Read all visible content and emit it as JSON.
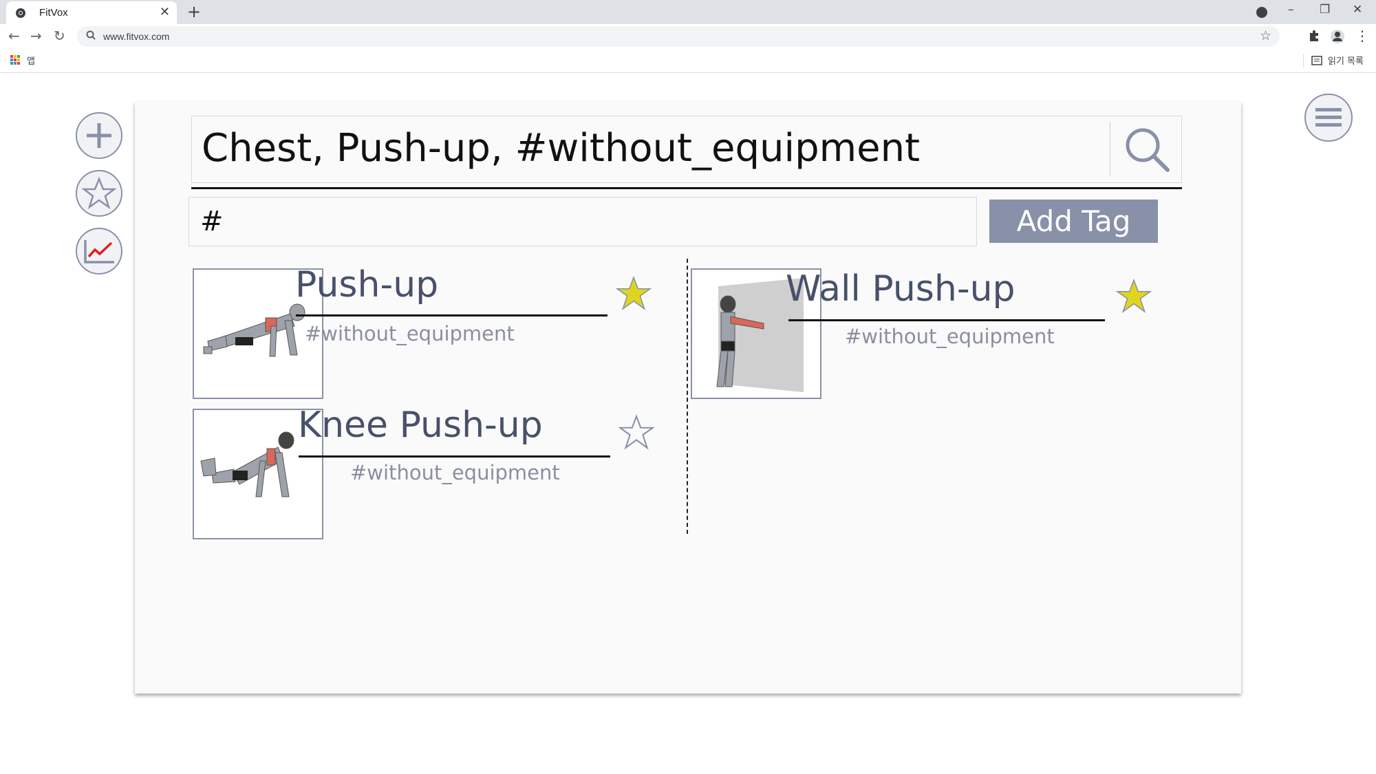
{
  "browser": {
    "tab_title": "FitVox",
    "new_tab_symbol": "+",
    "url": "www.fitvox.com",
    "bookmarks_apps_label": "앱",
    "reading_list_label": "읽기 목록",
    "window_controls": [
      "–",
      "❐",
      "✕"
    ]
  },
  "sidebar": {
    "buttons": [
      {
        "name": "add",
        "icon": "plus-icon"
      },
      {
        "name": "favorites",
        "icon": "star-outline-icon"
      },
      {
        "name": "stats",
        "icon": "line-chart-icon"
      }
    ]
  },
  "menu": {
    "icon": "hamburger-menu-icon"
  },
  "search": {
    "query": "Chest, Push-up, #without_equipment",
    "icon": "search-icon"
  },
  "tag": {
    "input_value": "#",
    "button_label": "Add Tag"
  },
  "results": [
    {
      "title": "Push-up",
      "tag": "#without_equipment",
      "favorite": true
    },
    {
      "title": "Knee Push-up",
      "tag": "#without_equipment",
      "favorite": false
    },
    {
      "title": "Wall Push-up",
      "tag": "#without_equipment",
      "favorite": true
    }
  ],
  "colors": {
    "accent": "#8891a8",
    "title_text": "#48516a",
    "tag_text": "#8a8fa0",
    "star_filled": "#e0d51e",
    "chart_line": "#e02020"
  }
}
